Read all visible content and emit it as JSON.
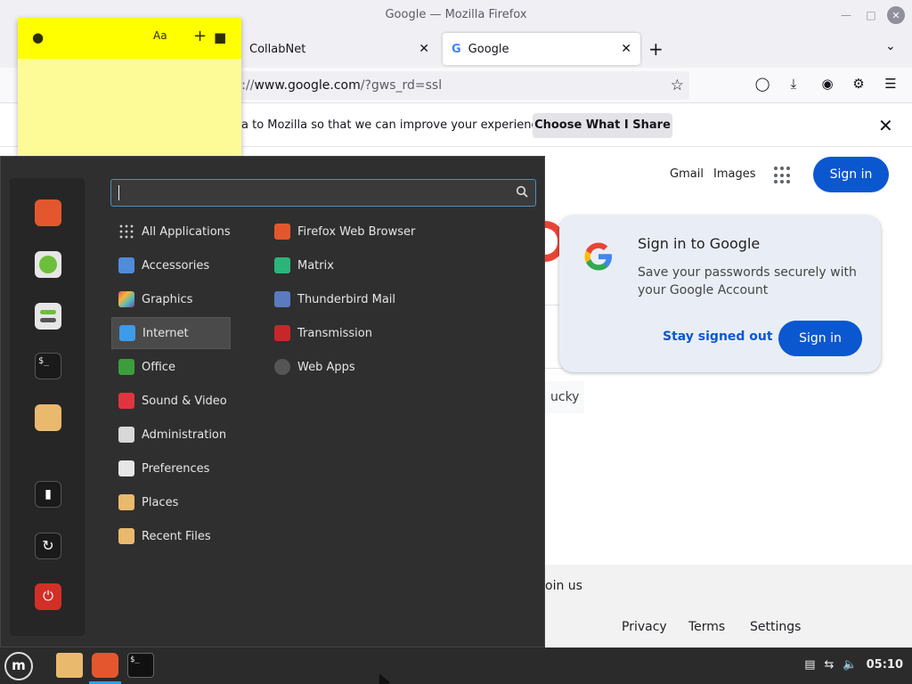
{
  "window": {
    "title": "Google — Mozilla Firefox"
  },
  "tabs": [
    {
      "label": "CollabNet"
    },
    {
      "label": "Google",
      "favicon": "G"
    }
  ],
  "toolbar": {
    "url_prefix": "s://",
    "url_host": "www.google.com",
    "url_path": "/?gws_rd=ssl"
  },
  "notification": {
    "text": "a to Mozilla so that we can improve your experience.",
    "button": "Choose What I Share"
  },
  "google": {
    "gmail": "Gmail",
    "images": "Images",
    "signin": "Sign in",
    "lucky": "ucky",
    "join": "oin us",
    "footer_links": [
      "Privacy",
      "Terms",
      "Settings"
    ],
    "popup": {
      "title": "Sign in to Google",
      "body": "Save your passwords securely with your Google Account",
      "stay": "Stay signed out",
      "signin": "Sign in"
    }
  },
  "sticky": {
    "font_icon": "Aa",
    "add": "+"
  },
  "menu": {
    "categories": [
      {
        "label": "All Applications",
        "icon": "grid-icon"
      },
      {
        "label": "Accessories",
        "icon": "accessories-icon"
      },
      {
        "label": "Graphics",
        "icon": "graphics-icon"
      },
      {
        "label": "Internet",
        "icon": "internet-icon"
      },
      {
        "label": "Office",
        "icon": "office-icon"
      },
      {
        "label": "Sound & Video",
        "icon": "sound-video-icon"
      },
      {
        "label": "Administration",
        "icon": "administration-icon"
      },
      {
        "label": "Preferences",
        "icon": "preferences-icon"
      },
      {
        "label": "Places",
        "icon": "folder-icon"
      },
      {
        "label": "Recent Files",
        "icon": "recent-files-icon"
      }
    ],
    "apps": [
      {
        "label": "Firefox Web Browser",
        "icon": "firefox-icon"
      },
      {
        "label": "Matrix",
        "icon": "matrix-icon"
      },
      {
        "label": "Thunderbird Mail",
        "icon": "thunderbird-icon"
      },
      {
        "label": "Transmission",
        "icon": "transmission-icon"
      },
      {
        "label": "Web Apps",
        "icon": "web-apps-icon"
      }
    ],
    "selected_category": "Internet"
  },
  "taskbar": {
    "clock": "05:10"
  }
}
